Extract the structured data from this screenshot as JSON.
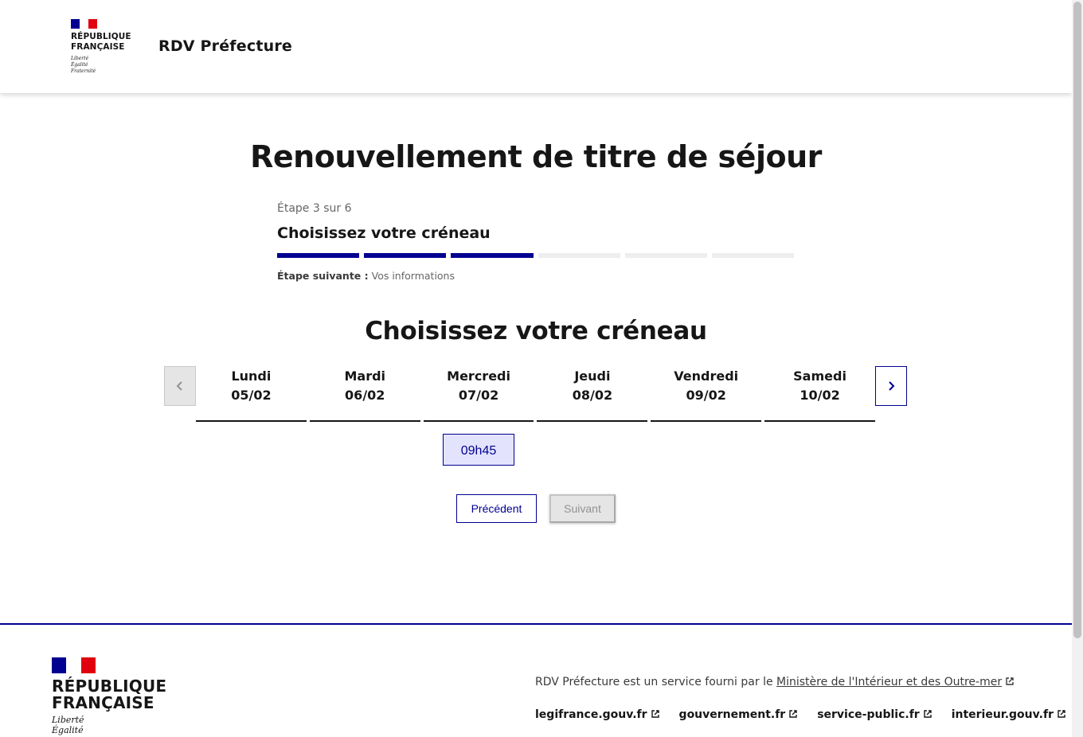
{
  "header": {
    "republic": "RÉPUBLIQUE FRANÇAISE",
    "republic_line1": "RÉPUBLIQUE",
    "republic_line2": "FRANÇAISE",
    "motto_1": "Liberté",
    "motto_2": "Égalité",
    "motto_3": "Fraternité",
    "service_title": "RDV Préfecture"
  },
  "main": {
    "page_title": "Renouvellement de titre de séjour",
    "step_count": "Étape 3 sur 6",
    "step_title": "Choisissez votre créneau",
    "steps_total": 6,
    "steps_done": 3,
    "next_step_label": "Étape suivante :",
    "next_step_value": "Vos informations",
    "section_title": "Choisissez votre créneau",
    "days": [
      {
        "name": "Lundi",
        "date": "05/02"
      },
      {
        "name": "Mardi",
        "date": "06/02"
      },
      {
        "name": "Mercredi",
        "date": "07/02"
      },
      {
        "name": "Jeudi",
        "date": "08/02"
      },
      {
        "name": "Vendredi",
        "date": "09/02"
      },
      {
        "name": "Samedi",
        "date": "10/02"
      }
    ],
    "slot": {
      "day": "Mercredi",
      "time": "09h45"
    },
    "prev_button": "Précédent",
    "next_button": "Suivant"
  },
  "footer": {
    "republic_line1": "RÉPUBLIQUE",
    "republic_line2": "FRANÇAISE",
    "motto_1": "Liberté",
    "motto_2": "Égalité",
    "description_prefix": "RDV Préfecture est un service fourni par le",
    "ministry_link": "Ministère de l'Intérieur et des Outre-mer",
    "links": [
      "legifrance.gouv.fr",
      "gouvernement.fr",
      "service-public.fr",
      "interieur.gouv.fr"
    ]
  },
  "colors": {
    "primary_blue": "#000091",
    "flag_red": "#e1000f",
    "slot_background": "#e3e3fd",
    "disabled_gray": "#e5e5e5"
  },
  "icons": [
    "chevron-left-icon",
    "chevron-right-icon",
    "external-link-icon",
    "marianne-logo"
  ]
}
